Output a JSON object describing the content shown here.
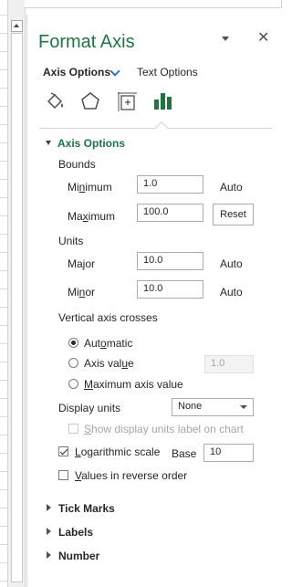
{
  "panel": {
    "title": "Format Axis",
    "tabs": {
      "axis_options": "Axis Options",
      "text_options": "Text Options"
    },
    "icons": [
      "fill-line-icon",
      "effects-icon",
      "size-properties-icon",
      "axis-options-icon"
    ]
  },
  "axis_options": {
    "header": "Axis Options",
    "bounds": {
      "label": "Bounds",
      "minimum": {
        "label_pre": "Mi",
        "label_u": "n",
        "label_post": "imum",
        "value": "1.0",
        "state": "Auto"
      },
      "maximum": {
        "label_pre": "Ma",
        "label_u": "x",
        "label_post": "imum",
        "value": "100.0",
        "button": "Reset"
      }
    },
    "units": {
      "label": "Units",
      "major": {
        "label_pre": "Ma",
        "label_u": "j",
        "label_post": "or",
        "value": "10.0",
        "state": "Auto"
      },
      "minor": {
        "label_pre": "Mi",
        "label_u": "n",
        "label_post": "or",
        "value": "10.0",
        "state": "Auto"
      }
    },
    "vertical_axis_crosses": {
      "label": "Vertical axis crosses",
      "automatic": {
        "pre": "Aut",
        "u": "o",
        "post": "matic",
        "checked": true
      },
      "axis_value": {
        "pre": "Axis val",
        "u": "u",
        "post": "e",
        "value": "1.0"
      },
      "maximum_axis_value": {
        "pre": "",
        "u": "M",
        "post": "aximum axis value"
      }
    },
    "display_units": {
      "label": "Display units",
      "value": "None"
    },
    "show_display_units": {
      "pre": "",
      "u": "S",
      "post": "how display units label on chart",
      "checked": false
    },
    "logarithmic": {
      "pre": "",
      "u": "L",
      "post": "ogarithmic scale",
      "checked": true,
      "base_label": "Base",
      "base_value": "10"
    },
    "reverse_order": {
      "pre": "",
      "u": "V",
      "post": "alues in reverse order",
      "checked": false
    }
  },
  "sections": [
    "Tick Marks",
    "Labels",
    "Number"
  ],
  "colors": {
    "accent": "#217346",
    "chevron": "#2e75b6"
  }
}
